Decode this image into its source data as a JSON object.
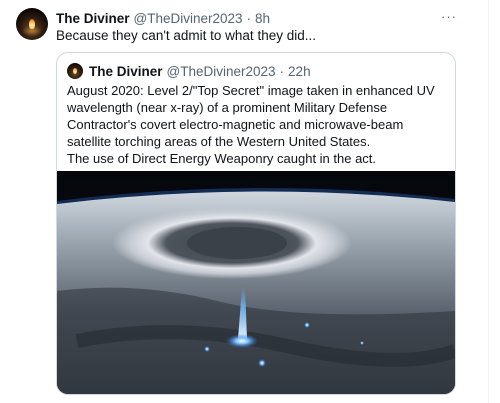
{
  "tweet": {
    "author_name": "The Diviner",
    "author_handle": "@TheDiviner2023",
    "separator": "·",
    "time": "8h",
    "text": "Because they can't admit to what they did...",
    "more_icon": "more-horizontal-icon",
    "more_label": "···"
  },
  "quote": {
    "author_name": "The Diviner",
    "author_handle": "@TheDiviner2023",
    "separator": "·",
    "time": "22h",
    "text_line1": "August 2020: Level 2/\"Top Secret\" image taken in enhanced UV wavelength (near x-ray) of a prominent Military Defense Contractor's covert electro-magnetic and microwave-beam satellite torching areas of the Western United States.",
    "text_line2": "The use of Direct Energy Weaponry caught in the act."
  },
  "colors": {
    "text_primary": "#0f1419",
    "text_secondary": "#536471",
    "border": "#cfd9de",
    "beam": "#5aa8ff"
  }
}
